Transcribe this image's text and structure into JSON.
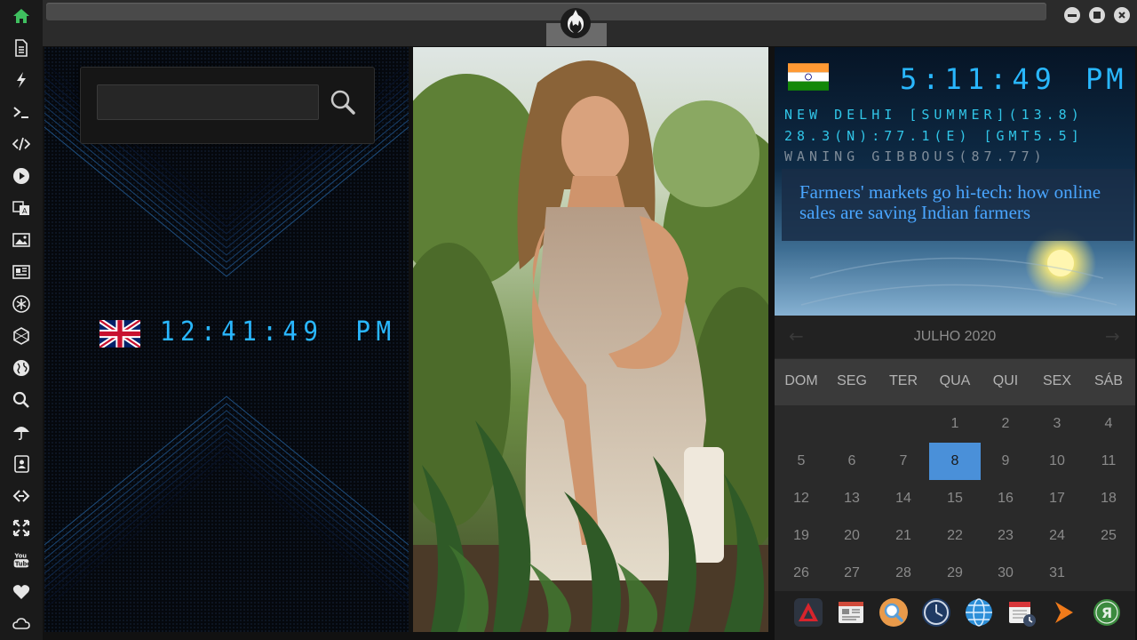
{
  "sidebar": {
    "items": [
      {
        "name": "home-icon"
      },
      {
        "name": "document-icon"
      },
      {
        "name": "lightning-icon"
      },
      {
        "name": "terminal-icon"
      },
      {
        "name": "code-icon"
      },
      {
        "name": "play-icon"
      },
      {
        "name": "translate-icon"
      },
      {
        "name": "image-icon"
      },
      {
        "name": "newspaper-icon"
      },
      {
        "name": "asterisk-icon"
      },
      {
        "name": "hexagon-icon"
      },
      {
        "name": "globe-icon"
      },
      {
        "name": "search-icon"
      },
      {
        "name": "umbrella-icon"
      },
      {
        "name": "contacts-icon"
      },
      {
        "name": "link-icon"
      },
      {
        "name": "expand-icon"
      },
      {
        "name": "youtube-icon",
        "label": "You Tube"
      },
      {
        "name": "heart-icon"
      },
      {
        "name": "cloud-icon"
      }
    ],
    "active_color": "#3fbf5f"
  },
  "search": {
    "value": "",
    "placeholder": ""
  },
  "clock_uk": {
    "time": "12:41:49",
    "ampm": "PM"
  },
  "clock_in": {
    "time": "5:11:49",
    "ampm": "PM"
  },
  "location": {
    "line1": "NEW DELHI [SUMMER](13.8)",
    "line2": "28.3(N):77.1(E) [GMT5.5]",
    "line3": "WANING GIBBOUS(87.77)"
  },
  "news": {
    "headline": "Farmers' markets go hi-tech: how online sales are saving Indian farmers"
  },
  "calendar": {
    "title": "JULHO 2020",
    "prev": "←",
    "next": "→",
    "weekdays": [
      "DOM",
      "SEG",
      "TER",
      "QUA",
      "QUI",
      "SEX",
      "SÁB"
    ],
    "weeks": [
      [
        "",
        "",
        "",
        "1",
        "2",
        "3",
        "4"
      ],
      [
        "5",
        "6",
        "7",
        "8",
        "9",
        "10",
        "11"
      ],
      [
        "12",
        "13",
        "14",
        "15",
        "16",
        "17",
        "18"
      ],
      [
        "19",
        "20",
        "21",
        "22",
        "23",
        "24",
        "25"
      ],
      [
        "26",
        "27",
        "28",
        "29",
        "30",
        "31",
        ""
      ]
    ],
    "selected": "8"
  },
  "dock": {
    "items": [
      "arrow-app-icon",
      "news-app-icon",
      "search-app-icon",
      "clock-app-icon",
      "globe-app-icon",
      "calendar-app-icon",
      "play-app-icon",
      "yandex-app-icon"
    ],
    "yandex_label": "Я"
  },
  "colors": {
    "digital_blue": "#29b7ff",
    "info_cyan": "#31c6e8",
    "info_yellow": "#e8e05a",
    "info_grey": "#7f8c99",
    "selected_day": "#4a90d9",
    "news_text": "#4aa6ff"
  }
}
